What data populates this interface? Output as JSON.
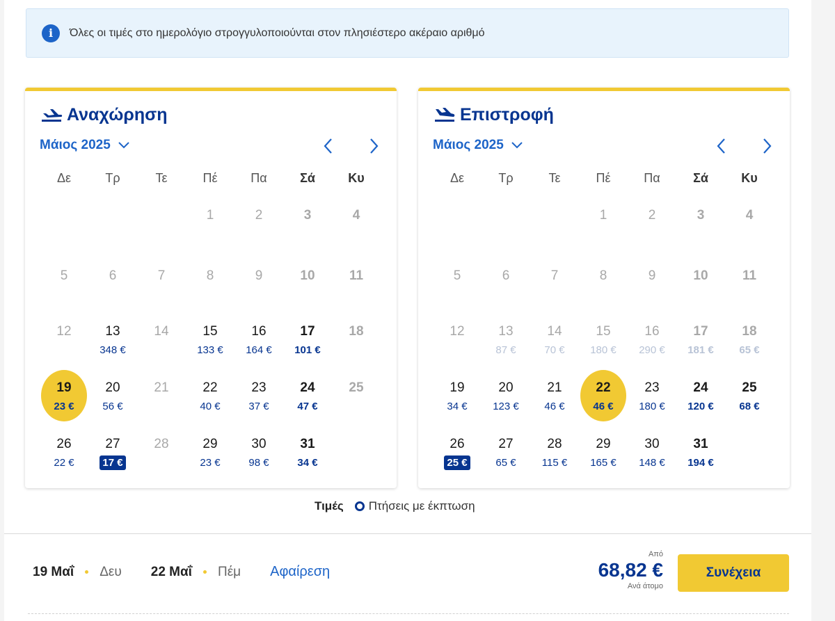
{
  "info": {
    "icon": "info-icon",
    "text": "Όλες οι τιμές στο ημερολόγιο στρογγυλοποιούνται στον πλησιέστερο ακέραιο αριθμό"
  },
  "departure": {
    "title": "Αναχώρηση",
    "icon": "plane-departure-icon",
    "month": "Μάιος 2025",
    "weekdays": [
      "Δε",
      "Τρ",
      "Τε",
      "Πέ",
      "Πα",
      "Σά",
      "Κυ"
    ],
    "days": [
      {
        "n": "1",
        "p": ""
      },
      {
        "n": "2",
        "p": ""
      },
      {
        "n": "3",
        "p": ""
      },
      {
        "n": "4",
        "p": ""
      },
      {
        "n": "5",
        "p": ""
      },
      {
        "n": "6",
        "p": ""
      },
      {
        "n": "7",
        "p": ""
      },
      {
        "n": "8",
        "p": ""
      },
      {
        "n": "9",
        "p": ""
      },
      {
        "n": "10",
        "p": ""
      },
      {
        "n": "11",
        "p": ""
      },
      {
        "n": "12",
        "p": ""
      },
      {
        "n": "13",
        "p": "348 €"
      },
      {
        "n": "14",
        "p": ""
      },
      {
        "n": "15",
        "p": "133 €"
      },
      {
        "n": "16",
        "p": "164 €"
      },
      {
        "n": "17",
        "p": "101 €"
      },
      {
        "n": "18",
        "p": ""
      },
      {
        "n": "19",
        "p": "23 €"
      },
      {
        "n": "20",
        "p": "56 €"
      },
      {
        "n": "21",
        "p": ""
      },
      {
        "n": "22",
        "p": "40 €"
      },
      {
        "n": "23",
        "p": "37 €"
      },
      {
        "n": "24",
        "p": "47 €"
      },
      {
        "n": "25",
        "p": ""
      },
      {
        "n": "26",
        "p": "22 €"
      },
      {
        "n": "27",
        "p": "17 €"
      },
      {
        "n": "28",
        "p": ""
      },
      {
        "n": "29",
        "p": "23 €"
      },
      {
        "n": "30",
        "p": "98 €"
      },
      {
        "n": "31",
        "p": "34 €"
      }
    ]
  },
  "return": {
    "title": "Επιστροφή",
    "icon": "plane-arrival-icon",
    "month": "Μάιος 2025",
    "weekdays": [
      "Δε",
      "Τρ",
      "Τε",
      "Πέ",
      "Πα",
      "Σά",
      "Κυ"
    ],
    "days": [
      {
        "n": "1",
        "p": ""
      },
      {
        "n": "2",
        "p": ""
      },
      {
        "n": "3",
        "p": ""
      },
      {
        "n": "4",
        "p": ""
      },
      {
        "n": "5",
        "p": ""
      },
      {
        "n": "6",
        "p": ""
      },
      {
        "n": "7",
        "p": ""
      },
      {
        "n": "8",
        "p": ""
      },
      {
        "n": "9",
        "p": ""
      },
      {
        "n": "10",
        "p": ""
      },
      {
        "n": "11",
        "p": ""
      },
      {
        "n": "12",
        "p": ""
      },
      {
        "n": "13",
        "p": "87 €"
      },
      {
        "n": "14",
        "p": "70 €"
      },
      {
        "n": "15",
        "p": "180 €"
      },
      {
        "n": "16",
        "p": "290 €"
      },
      {
        "n": "17",
        "p": "181 €"
      },
      {
        "n": "18",
        "p": "65 €"
      },
      {
        "n": "19",
        "p": "34 €"
      },
      {
        "n": "20",
        "p": "123 €"
      },
      {
        "n": "21",
        "p": "46 €"
      },
      {
        "n": "22",
        "p": "46 €"
      },
      {
        "n": "23",
        "p": "180 €"
      },
      {
        "n": "24",
        "p": "120 €"
      },
      {
        "n": "25",
        "p": "68 €"
      },
      {
        "n": "26",
        "p": "25 €"
      },
      {
        "n": "27",
        "p": "65 €"
      },
      {
        "n": "28",
        "p": "115 €"
      },
      {
        "n": "29",
        "p": "165 €"
      },
      {
        "n": "30",
        "p": "148 €"
      },
      {
        "n": "31",
        "p": "194 €"
      }
    ]
  },
  "legend": {
    "title": "Τιμές",
    "label": "Πτήσεις με έκπτωση"
  },
  "summary": {
    "depart_date": "19 Μαΐ",
    "depart_day": "Δευ",
    "return_date": "22 Μαΐ",
    "return_day": "Πέμ",
    "remove": "Αφαίρεση",
    "from_label": "Από",
    "total": "68,82 €",
    "per_person": "Ανά άτομο",
    "cta": "Συνέχεια"
  },
  "colors": {
    "brand": "#073590",
    "accent": "#f1c933",
    "link": "#1d64c8"
  }
}
